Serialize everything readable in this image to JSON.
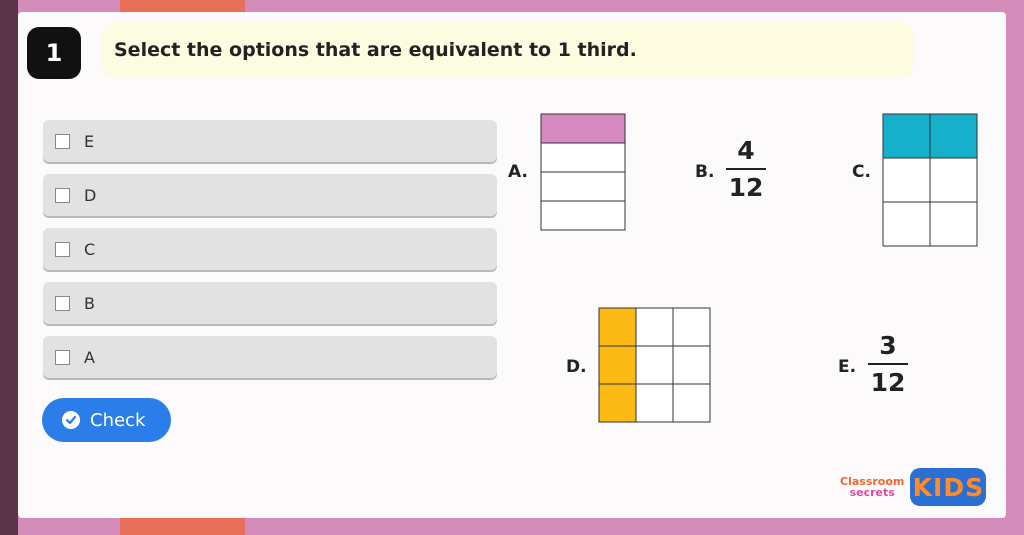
{
  "question": {
    "number": "1",
    "text": "Select the options that are equivalent to 1 third."
  },
  "options": [
    {
      "label": "E",
      "checked": false
    },
    {
      "label": "D",
      "checked": false
    },
    {
      "label": "C",
      "checked": false
    },
    {
      "label": "B",
      "checked": false
    },
    {
      "label": "A",
      "checked": false
    }
  ],
  "check_button": {
    "label": "Check",
    "icon": "check-circle-icon"
  },
  "figures": {
    "a": {
      "label": "A.",
      "rows": 4,
      "shaded_rows": 1,
      "color": "#d68ac0"
    },
    "b": {
      "label": "B.",
      "numerator": "4",
      "denominator": "12"
    },
    "c": {
      "label": "C.",
      "rows": 3,
      "cols": 2,
      "shaded_rows": 1,
      "color": "#16b0cc"
    },
    "d": {
      "label": "D.",
      "rows": 3,
      "cols": 3,
      "shaded_cols": 1,
      "color": "#fbbb14"
    },
    "e": {
      "label": "E.",
      "numerator": "3",
      "denominator": "12"
    }
  },
  "logo": {
    "line1": "Classroom",
    "line2": "secrets",
    "badge": "KIDS"
  },
  "colors": {
    "accent": "#2b7de9",
    "question_bg": "#fdfbe0",
    "background": "#d48cba"
  }
}
